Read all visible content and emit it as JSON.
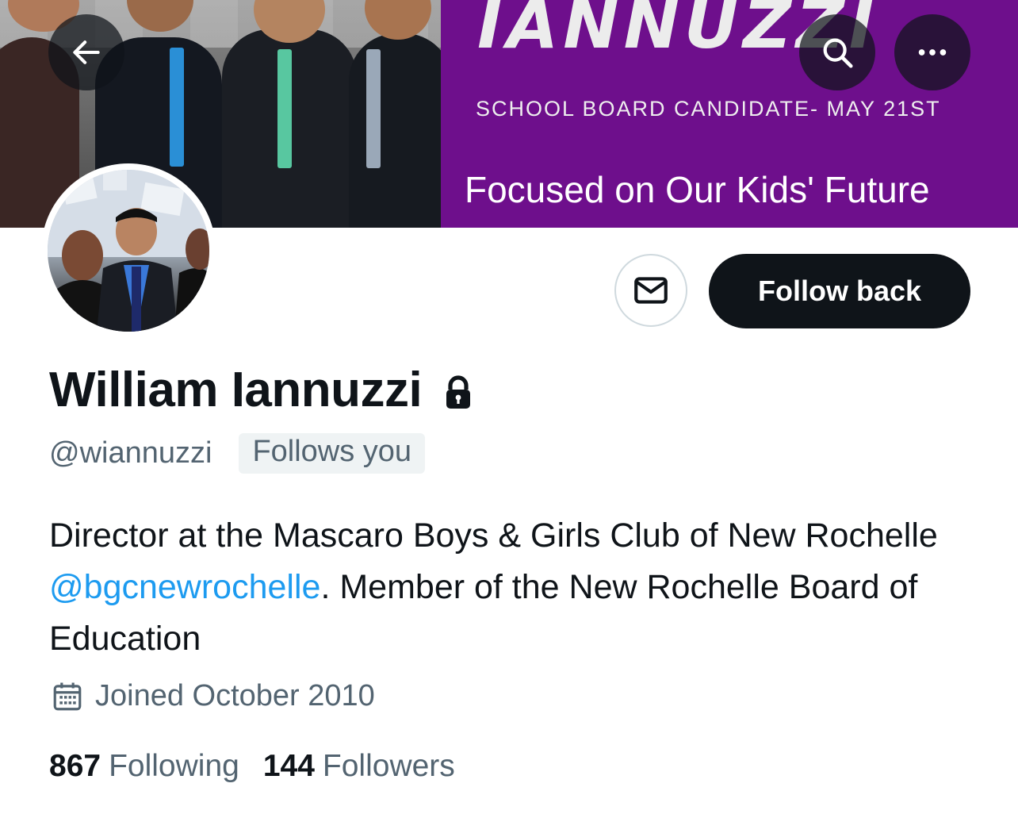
{
  "banner": {
    "name_text": "IANNUZZI",
    "subtitle": "SCHOOL BOARD CANDIDATE- MAY 21ST",
    "tagline": "Focused on Our Kids' Future",
    "purple_color": "#6e0f8c"
  },
  "nav": {
    "back_icon": "arrow-left-icon",
    "search_icon": "search-icon",
    "more_icon": "more-icon"
  },
  "profile": {
    "display_name": "William Iannuzzi",
    "handle": "@wiannuzzi",
    "follows_you": "Follows you",
    "bio_before": "Director at the Mascaro Boys & Girls Club of New Rochelle ",
    "bio_mention": "@bgcnewrochelle",
    "bio_after": ". Member of the New Rochelle Board of Education",
    "joined": "Joined October 2010",
    "following_count": "867",
    "following_label": "Following",
    "followers_count": "144",
    "followers_label": "Followers"
  },
  "actions": {
    "follow_back": "Follow back",
    "message_icon": "mail-icon"
  },
  "colors": {
    "primary_text": "#0f1419",
    "secondary_text": "#536471",
    "link": "#1d9bf0",
    "button_dark": "#0f1419"
  }
}
